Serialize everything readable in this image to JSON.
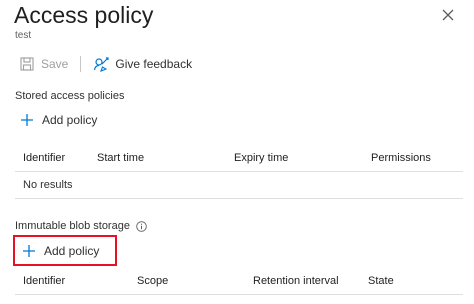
{
  "header": {
    "title": "Access policy",
    "subtitle": "test"
  },
  "toolbar": {
    "save_label": "Save",
    "feedback_label": "Give feedback"
  },
  "stored": {
    "section_label": "Stored access policies",
    "add_label": "Add policy",
    "columns": [
      "Identifier",
      "Start time",
      "Expiry time",
      "Permissions"
    ],
    "empty_text": "No results"
  },
  "immutable": {
    "section_label": "Immutable blob storage",
    "add_label": "Add policy",
    "columns": [
      "Identifier",
      "Scope",
      "Retention interval",
      "State"
    ]
  },
  "colors": {
    "accent": "#0078d4",
    "highlight": "#e81123",
    "divider": "#e1dfdd"
  },
  "icons": {
    "close": "close-icon",
    "save": "save-icon",
    "feedback": "feedback-icon",
    "add": "plus-icon",
    "info": "info-icon"
  }
}
